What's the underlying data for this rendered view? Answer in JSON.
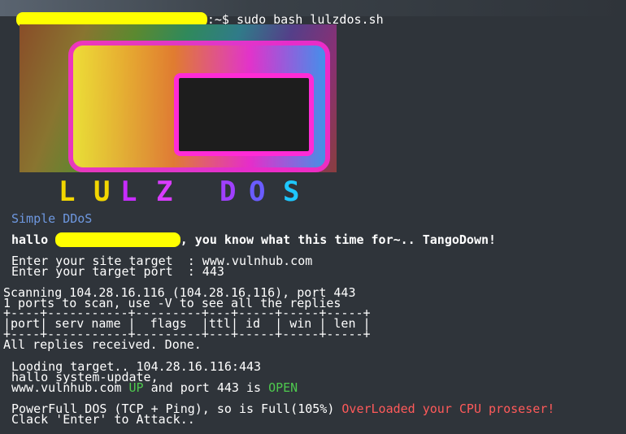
{
  "prompt": {
    "suffix": ":~$ sudo bash lulzdos.sh"
  },
  "logo": {
    "letters": [
      "L",
      "U",
      "L",
      "Z",
      "D",
      "O",
      "S"
    ],
    "colors": [
      "#f2d600",
      "#f2d600",
      "#c72cff",
      "#d93cff",
      "#a040ff",
      "#6a5cff",
      "#1ec7ff"
    ]
  },
  "app": {
    "subtitle": "Simple DDoS",
    "greeting_prefix": "hallo ",
    "greeting_suffix": ", you know what this time for~.. TangoDown!",
    "site_target_label": "Enter your site target  : www.vulnhub.com",
    "port_label": "Enter your target port  : 443",
    "scan_line1": "Scanning 104.28.16.116 (104.28.16.116), port 443",
    "scan_line2": "1 ports to scan, use -V to see all the replies",
    "table_border": "+----+-----------+---------+---+-----+-----+-----+",
    "table_header": "|port| serv name |  flags  |ttl| id  | win | len |",
    "all_replies": "All replies received. Done.",
    "loading": "Looding target.. 104.28.16.116:443",
    "hallo_user": "hallo system-update,",
    "host_prefix": "www.vulnhub.com ",
    "host_status": "UP",
    "port_mid": " and port 443 is ",
    "port_status": "OPEN",
    "dos_prefix": "PowerFull DOS (TCP + Ping), so is Full(105%) ",
    "dos_warning": "OverLoaded your CPU proseser!",
    "attack": "Clack 'Enter' to Attack.."
  }
}
